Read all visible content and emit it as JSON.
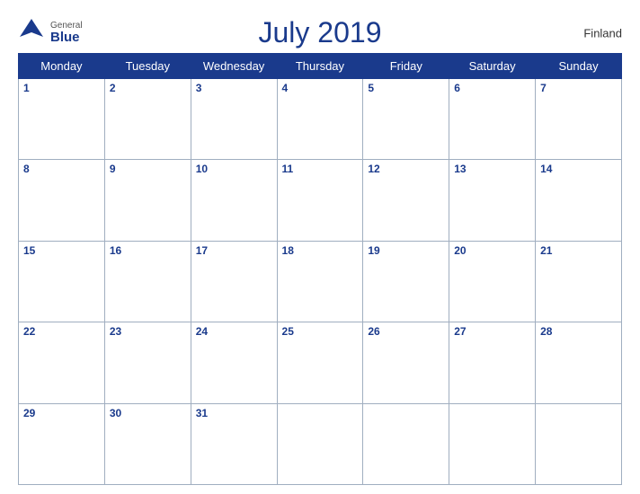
{
  "header": {
    "logo_general": "General",
    "logo_blue": "Blue",
    "month_year": "July 2019",
    "country": "Finland"
  },
  "days_of_week": [
    "Monday",
    "Tuesday",
    "Wednesday",
    "Thursday",
    "Friday",
    "Saturday",
    "Sunday"
  ],
  "weeks": [
    [
      1,
      2,
      3,
      4,
      5,
      6,
      7
    ],
    [
      8,
      9,
      10,
      11,
      12,
      13,
      14
    ],
    [
      15,
      16,
      17,
      18,
      19,
      20,
      21
    ],
    [
      22,
      23,
      24,
      25,
      26,
      27,
      28
    ],
    [
      29,
      30,
      31,
      null,
      null,
      null,
      null
    ]
  ],
  "colors": {
    "header_bg": "#1a3a8c",
    "row_header_bg": "#c8d0e8",
    "border": "#a0aec0",
    "day_num": "#1a3a8c"
  }
}
